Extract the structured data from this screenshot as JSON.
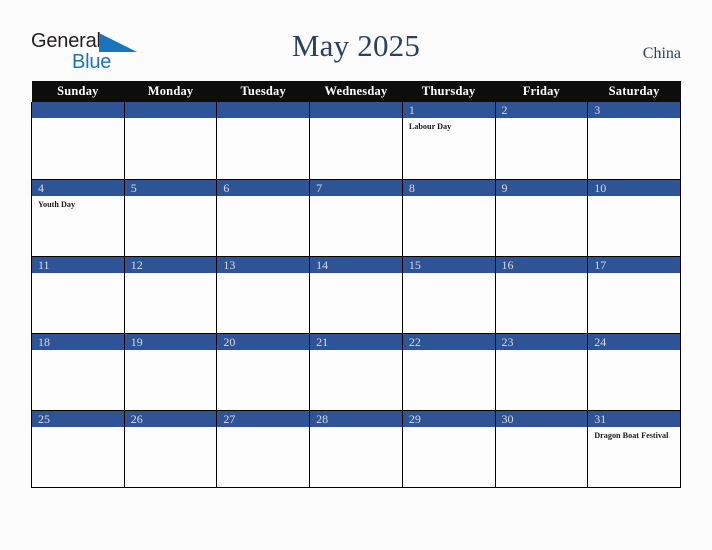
{
  "brand": {
    "name_part1": "General",
    "name_part2": "Blue",
    "triangle_color": "#1b75bc"
  },
  "header": {
    "title": "May 2025",
    "country": "China"
  },
  "colors": {
    "accent_blue": "#2f5496",
    "header_black": "#0d0d0d",
    "title_navy": "#2b4162",
    "brand_blue": "#1b75bc",
    "page_background": "#fcfcfd",
    "day_number": "#d9d9e2"
  },
  "calendar": {
    "weekday_headers": [
      "Sunday",
      "Monday",
      "Tuesday",
      "Wednesday",
      "Thursday",
      "Friday",
      "Saturday"
    ],
    "weeks": [
      [
        {
          "day": "",
          "events": []
        },
        {
          "day": "",
          "events": []
        },
        {
          "day": "",
          "events": []
        },
        {
          "day": "",
          "events": []
        },
        {
          "day": "1",
          "events": [
            "Labour Day"
          ]
        },
        {
          "day": "2",
          "events": []
        },
        {
          "day": "3",
          "events": []
        }
      ],
      [
        {
          "day": "4",
          "events": [
            "Youth Day"
          ]
        },
        {
          "day": "5",
          "events": []
        },
        {
          "day": "6",
          "events": []
        },
        {
          "day": "7",
          "events": []
        },
        {
          "day": "8",
          "events": []
        },
        {
          "day": "9",
          "events": []
        },
        {
          "day": "10",
          "events": []
        }
      ],
      [
        {
          "day": "11",
          "events": []
        },
        {
          "day": "12",
          "events": []
        },
        {
          "day": "13",
          "events": []
        },
        {
          "day": "14",
          "events": []
        },
        {
          "day": "15",
          "events": []
        },
        {
          "day": "16",
          "events": []
        },
        {
          "day": "17",
          "events": []
        }
      ],
      [
        {
          "day": "18",
          "events": []
        },
        {
          "day": "19",
          "events": []
        },
        {
          "day": "20",
          "events": []
        },
        {
          "day": "21",
          "events": []
        },
        {
          "day": "22",
          "events": []
        },
        {
          "day": "23",
          "events": []
        },
        {
          "day": "24",
          "events": []
        }
      ],
      [
        {
          "day": "25",
          "events": []
        },
        {
          "day": "26",
          "events": []
        },
        {
          "day": "27",
          "events": []
        },
        {
          "day": "28",
          "events": []
        },
        {
          "day": "29",
          "events": []
        },
        {
          "day": "30",
          "events": []
        },
        {
          "day": "31",
          "events": [
            "Dragon Boat Festival"
          ]
        }
      ]
    ]
  }
}
